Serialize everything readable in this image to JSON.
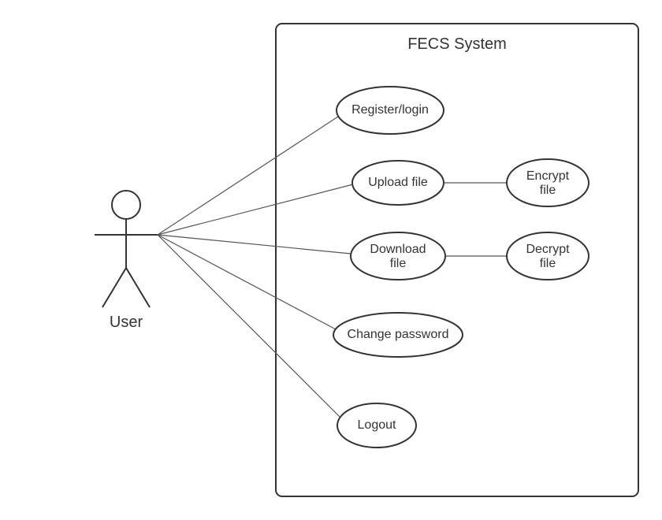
{
  "system": {
    "title": "FECS System"
  },
  "actor": {
    "label": "User"
  },
  "usecases": {
    "register": "Register/login",
    "upload": "Upload file",
    "download_l1": "Download",
    "download_l2": "file",
    "change_pw": "Change password",
    "logout": "Logout",
    "encrypt_l1": "Encrypt",
    "encrypt_l2": "file",
    "decrypt_l1": "Decrypt",
    "decrypt_l2": "file"
  }
}
